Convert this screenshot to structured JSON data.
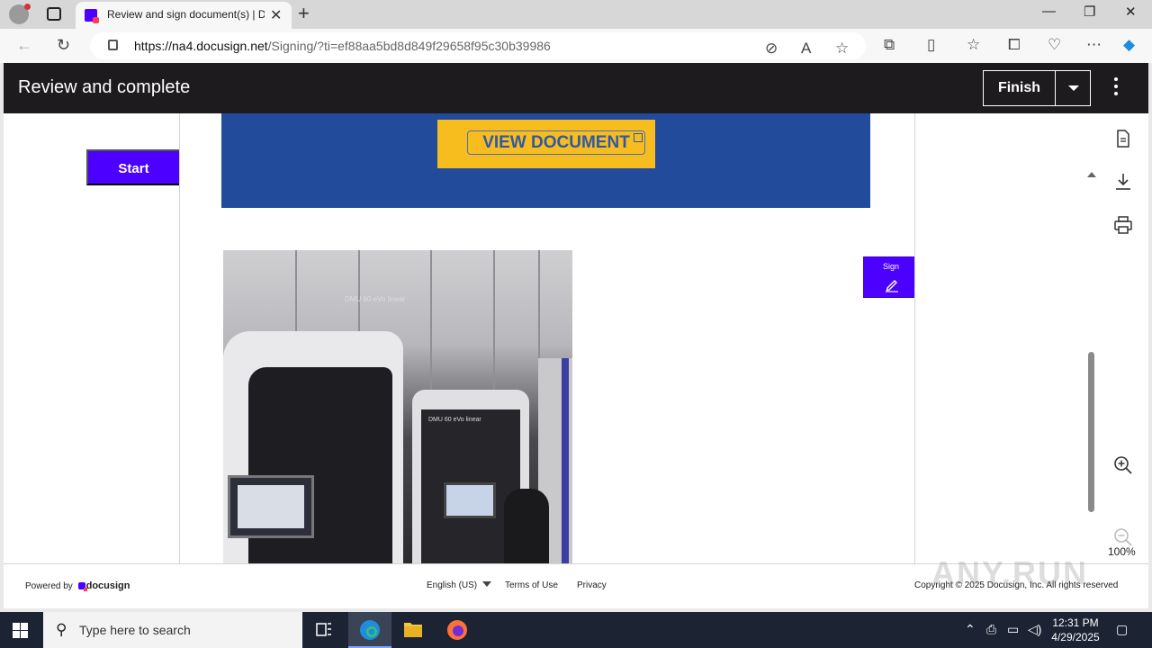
{
  "browser": {
    "tab_title": "Review and sign document(s) | D",
    "url_domain": "https://na4.docusign.net",
    "url_path": "/Signing/?ti=ef88aa5bd8d849f29658f95c30b39986"
  },
  "header": {
    "title": "Review and complete",
    "finish_label": "Finish"
  },
  "body": {
    "start_label": "Start",
    "view_document_label": "VIEW DOCUMENT",
    "sign_label": "Sign",
    "photo_labels": {
      "machine1": "DMU 60 eVo linear",
      "machine2": "DMU 60 eVo linear"
    },
    "zoom": "100%"
  },
  "footer": {
    "powered_by": "Powered by",
    "brand": "docusign",
    "language": "English (US)",
    "terms": "Terms of Use",
    "privacy": "Privacy",
    "copyright": "Copyright © 2025 Docusign, Inc. All rights reserved"
  },
  "watermark": "ANY.RUN",
  "taskbar": {
    "search_placeholder": "Type here to search",
    "time": "12:31 PM",
    "date": "4/29/2025"
  },
  "colors": {
    "brand_purple": "#4c00ff",
    "banner_blue": "#234b9c",
    "button_yellow": "#f7bc1e",
    "header_dark": "#1e1b1e"
  }
}
